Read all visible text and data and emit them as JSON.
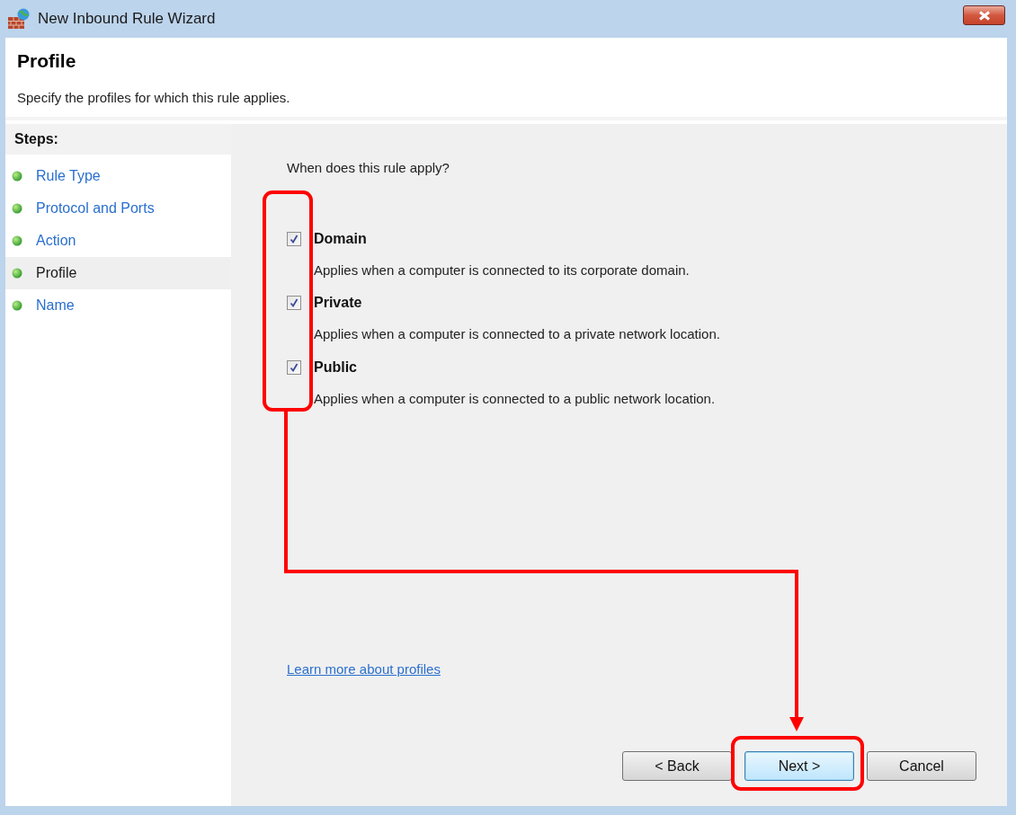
{
  "window": {
    "title": "New Inbound Rule Wizard"
  },
  "header": {
    "title": "Profile",
    "description": "Specify the profiles for which this rule applies."
  },
  "steps": {
    "heading": "Steps:",
    "items": [
      {
        "label": "Rule Type",
        "selected": false
      },
      {
        "label": "Protocol and Ports",
        "selected": false
      },
      {
        "label": "Action",
        "selected": false
      },
      {
        "label": "Profile",
        "selected": true
      },
      {
        "label": "Name",
        "selected": false
      }
    ]
  },
  "question": "When does this rule apply?",
  "profiles": [
    {
      "label": "Domain",
      "description": "Applies when a computer is connected to its corporate domain.",
      "checked": true
    },
    {
      "label": "Private",
      "description": "Applies when a computer is connected to a private network location.",
      "checked": true
    },
    {
      "label": "Public",
      "description": "Applies when a computer is connected to a public network location.",
      "checked": true
    }
  ],
  "link": "Learn more about profiles",
  "buttons": [
    {
      "label": "< Back",
      "kind": "normal"
    },
    {
      "label": "Next >",
      "kind": "default"
    },
    {
      "label": "Cancel",
      "kind": "normal"
    }
  ]
}
